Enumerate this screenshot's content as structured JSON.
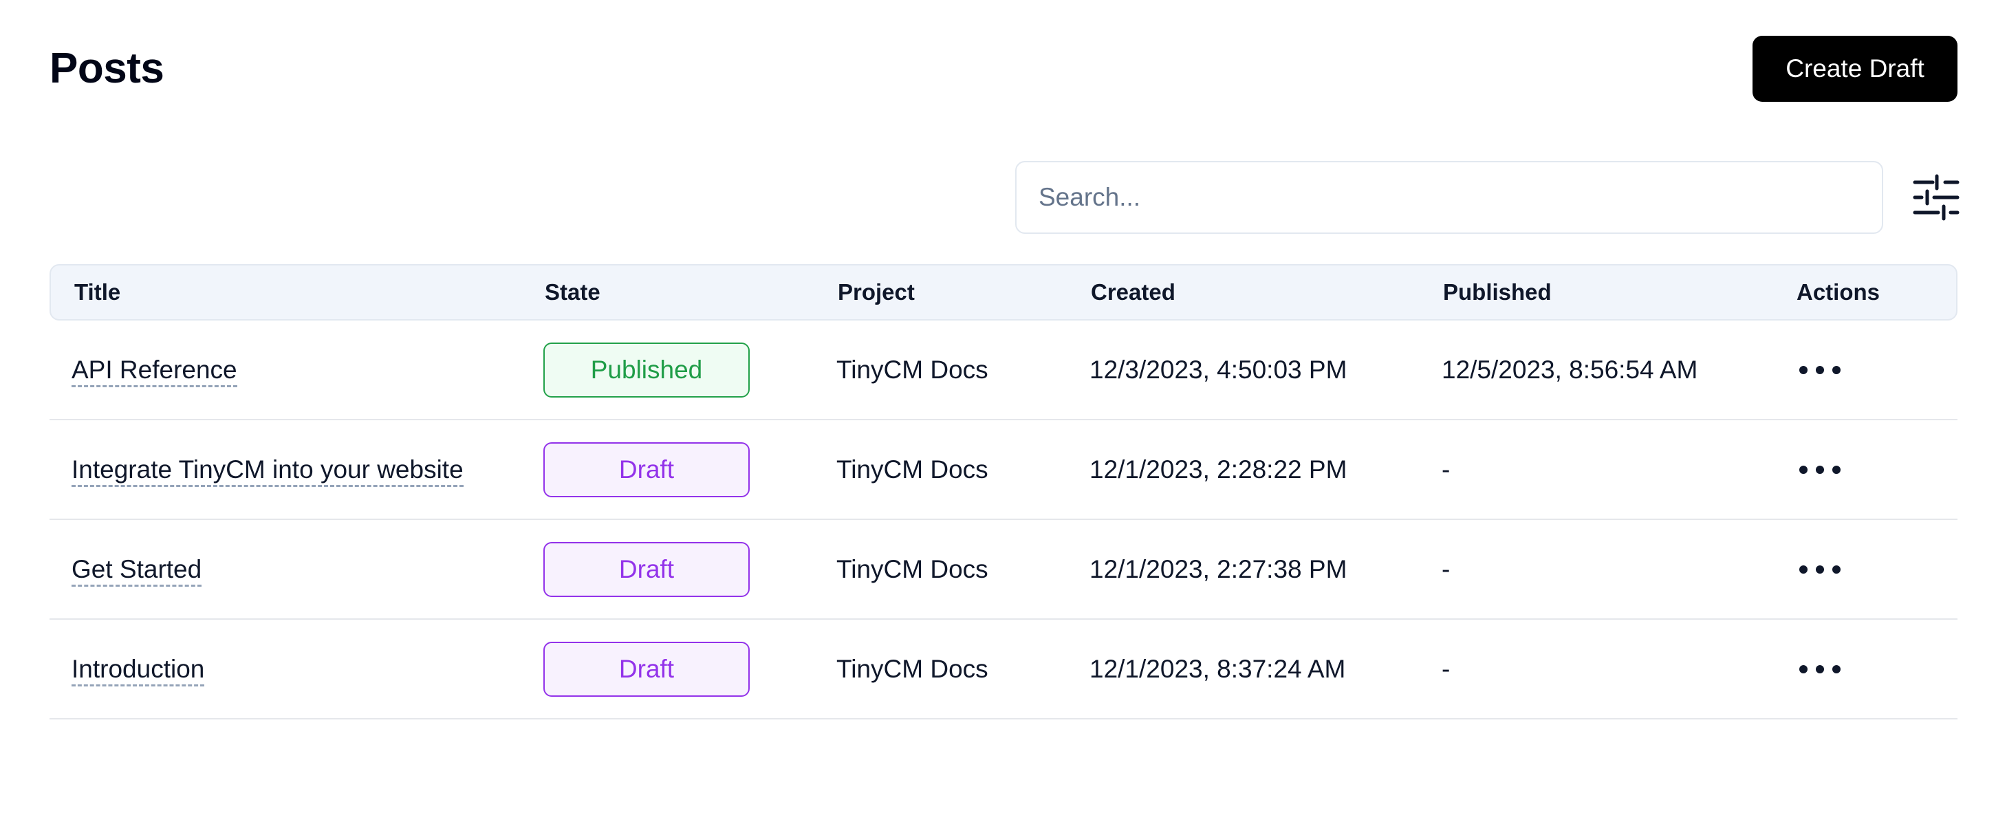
{
  "header": {
    "title": "Posts",
    "create_label": "Create Draft"
  },
  "search": {
    "placeholder": "Search...",
    "value": ""
  },
  "icons": {
    "filter": "sliders-icon",
    "actions": "ellipsis-icon"
  },
  "colors": {
    "primary_button": "#000000",
    "header_bg": "#f1f5fb",
    "published": "#1f9d47",
    "draft": "#9333ea"
  },
  "table": {
    "columns": [
      "Title",
      "State",
      "Project",
      "Created",
      "Published",
      "Actions"
    ],
    "rows": [
      {
        "title": "API Reference",
        "state": "Published",
        "project": "TinyCM Docs",
        "created": "12/3/2023, 4:50:03 PM",
        "published": "12/5/2023, 8:56:54 AM"
      },
      {
        "title": "Integrate TinyCM into your website",
        "state": "Draft",
        "project": "TinyCM Docs",
        "created": "12/1/2023, 2:28:22 PM",
        "published": "-"
      },
      {
        "title": "Get Started",
        "state": "Draft",
        "project": "TinyCM Docs",
        "created": "12/1/2023, 2:27:38 PM",
        "published": "-"
      },
      {
        "title": "Introduction",
        "state": "Draft",
        "project": "TinyCM Docs",
        "created": "12/1/2023, 8:37:24 AM",
        "published": "-"
      }
    ]
  }
}
